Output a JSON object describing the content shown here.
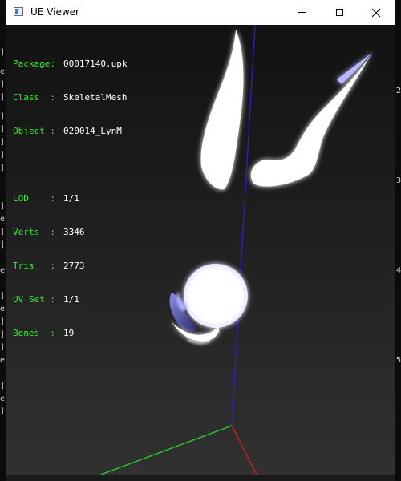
{
  "window": {
    "title": "UE Viewer",
    "controls": [
      "minimize",
      "maximize",
      "close"
    ]
  },
  "info": {
    "package": {
      "label": "Package:",
      "value": "00017140.upk"
    },
    "class": {
      "label": "Class  :",
      "value": "SkeletalMesh"
    },
    "object": {
      "label": "Object :",
      "value": "020014_LynM"
    },
    "lod": {
      "label": "LOD    :",
      "value": "1/1"
    },
    "verts": {
      "label": "Verts  :",
      "value": "3346"
    },
    "tris": {
      "label": "Tris   :",
      "value": "2773"
    },
    "uvset": {
      "label": "UV Set :",
      "value": "1/1"
    },
    "bones": {
      "label": "Bones  :",
      "value": "19"
    }
  },
  "background": {
    "left_glyphs": [
      "]",
      "",
      "e",
      "]",
      "]",
      "]",
      "]",
      "]",
      "]",
      "",
      "]",
      "e",
      "]",
      "]",
      "]",
      "",
      "e",
      "]",
      "]",
      "",
      "e",
      "]",
      "]",
      "]",
      "",
      "e",
      "]",
      "]",
      "",
      "e",
      "]",
      "]"
    ],
    "right_glyphs": [
      "2",
      "",
      "3",
      "",
      "4",
      "",
      "5",
      ""
    ]
  },
  "colors": {
    "info_label": "#39e639",
    "info_value": "#ffffff",
    "axis_x": "#d81e1e",
    "axis_y": "#2ad12a",
    "axis_z": "#2424c8"
  }
}
